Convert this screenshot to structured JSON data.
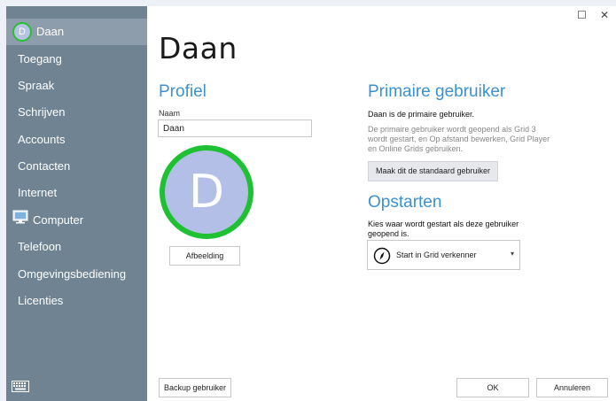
{
  "sidebar": {
    "user_avatar_letter": "D",
    "items": [
      {
        "label": "Daan"
      },
      {
        "label": "Toegang"
      },
      {
        "label": "Spraak"
      },
      {
        "label": "Schrijven"
      },
      {
        "label": "Accounts"
      },
      {
        "label": "Contacten"
      },
      {
        "label": "Internet"
      },
      {
        "label": "Computer"
      },
      {
        "label": "Telefoon"
      },
      {
        "label": "Omgevingsbediening"
      },
      {
        "label": "Licenties"
      }
    ],
    "keyboard_icon": "keyboard-icon"
  },
  "window_controls": {
    "maximize": "☐",
    "close": "✕"
  },
  "main": {
    "title": "Daan",
    "profile": {
      "heading": "Profiel",
      "name_label": "Naam",
      "name_value": "Daan",
      "avatar_letter": "D",
      "picture_button": "Afbeelding"
    },
    "primary_user": {
      "heading": "Primaire gebruiker",
      "status": "Daan is de primaire gebruiker.",
      "description": "De primaire gebruiker wordt geopend als Grid 3 wordt gestart, en Op afstand bewerken, Grid Player en Online Grids gebruiken.",
      "make_default_button": "Maak dit de standaard gebruiker"
    },
    "startup": {
      "heading": "Opstarten",
      "description": "Kies waar wordt gestart als deze gebruiker geopend is.",
      "selected_option": "Start in Grid verkenner"
    },
    "footer": {
      "backup_button": "Backup gebruiker",
      "ok_button": "OK",
      "cancel_button": "Annuleren"
    }
  },
  "colors": {
    "sidebar_bg": "#6f8393",
    "sidebar_active": "#8d9dab",
    "accent_blue": "#3c92d0",
    "avatar_ring": "#1ec132",
    "avatar_fill": "#b3bfe6"
  }
}
